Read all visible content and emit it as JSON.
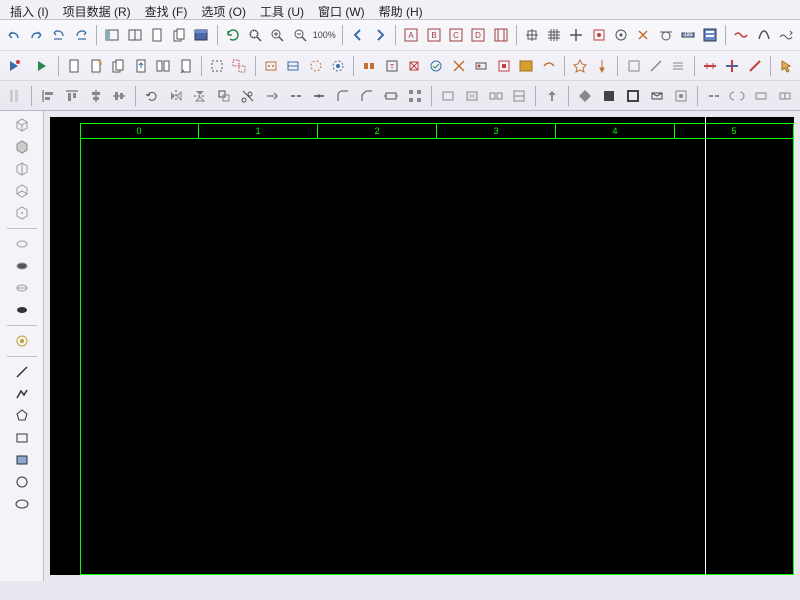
{
  "menu": {
    "insert": "插入 (I)",
    "projectData": "项目数据 (R)",
    "find": "查找 (F)",
    "options": "选项 (O)",
    "tools": "工具 (U)",
    "window": "窗口 (W)",
    "help": "帮助 (H)"
  },
  "zoom": {
    "percent": "100%"
  },
  "canvas": {
    "columns": [
      "0",
      "1",
      "2",
      "3",
      "4",
      "5"
    ]
  }
}
